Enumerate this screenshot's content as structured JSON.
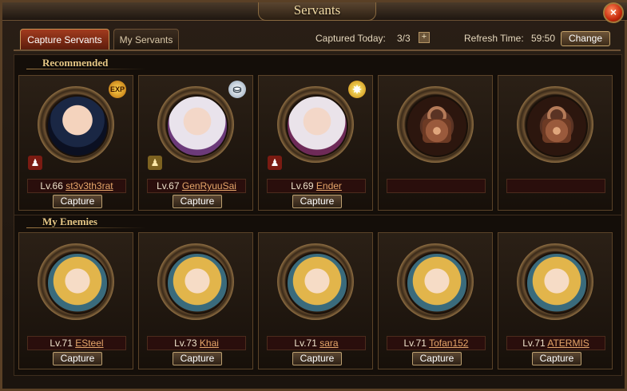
{
  "window": {
    "title": "Servants",
    "close_icon": "×"
  },
  "tabs": [
    {
      "label": "Capture Servants",
      "active": true
    },
    {
      "label": "My Servants",
      "active": false
    }
  ],
  "header": {
    "captured_label": "Captured Today:",
    "captured_value": "3/3",
    "plus_icon": "+",
    "refresh_label": "Refresh Time:",
    "refresh_value": "59:50",
    "change_label": "Change"
  },
  "recommended": {
    "label": "Recommended",
    "cards": [
      {
        "level": "Lv.66",
        "name": "st3v3th3rat",
        "button": "Capture",
        "badge": "EXP",
        "badge_icon": "exp-icon",
        "rank_icon": "red-warrior-icon"
      },
      {
        "level": "Lv.67",
        "name": "GenRyuuSai",
        "button": "Capture",
        "badge": "⛀",
        "badge_icon": "silver-coin-icon",
        "rank_icon": "gold-warrior-icon"
      },
      {
        "level": "Lv.69",
        "name": "Ender",
        "button": "Capture",
        "badge": "✸",
        "badge_icon": "star-icon",
        "rank_icon": "red-warrior-icon"
      },
      {
        "locked": true
      },
      {
        "locked": true
      }
    ]
  },
  "enemies": {
    "label": "My Enemies",
    "cards": [
      {
        "level": "Lv.71",
        "name": "ESteel",
        "button": "Capture"
      },
      {
        "level": "Lv.73",
        "name": "Khai",
        "button": "Capture"
      },
      {
        "level": "Lv.71",
        "name": "sara",
        "button": "Capture"
      },
      {
        "level": "Lv.71",
        "name": "Tofan152",
        "button": "Capture"
      },
      {
        "level": "Lv.71",
        "name": "ATERMIS",
        "button": "Capture"
      }
    ]
  }
}
